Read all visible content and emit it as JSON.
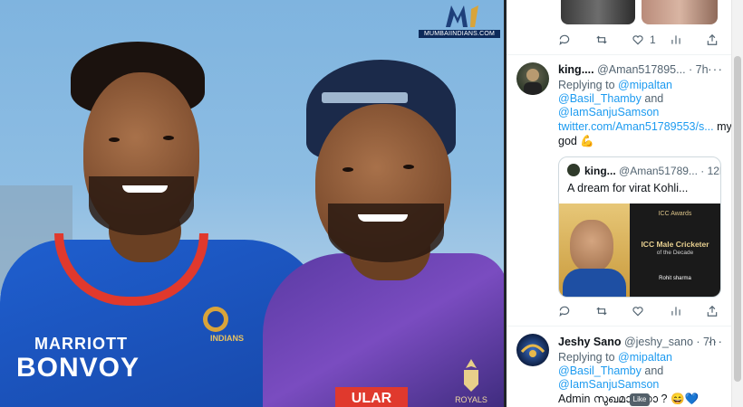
{
  "photo": {
    "logo_text": "MI",
    "url_text": "MUMBAIINDIANS.COM",
    "sponsor_line1": "MARRIOTT",
    "sponsor_line2": "BONVOY",
    "badge_text": "INDIANS",
    "crest_text": "ROYALS",
    "shirt_sponsor": "ULAR"
  },
  "feed": {
    "top_actions": {
      "like_count": "1"
    },
    "tweets": [
      {
        "name": "king....",
        "handle": "@Aman517895...",
        "time": "· 7h",
        "reply_prefix": "Replying to",
        "reply_to_1": "@mipaltan",
        "reply_to_2": "@Basil_Thamby",
        "reply_and": "and",
        "reply_to_3": "@IamSanjuSamson",
        "link": "twitter.com/Aman51789553/s...",
        "text_after_link": "my",
        "text_line2": "god 💪",
        "quote": {
          "name": "king...",
          "handle": "@Aman51789...",
          "time": "· 12h",
          "text": "A dream for virat Kohli...",
          "award_heading": "ICC Awards",
          "award_title_1": "ICC Male Cricketer",
          "award_title_2": "of the Decade",
          "award_name": "Rohit sharma"
        }
      },
      {
        "name": "Jeshy Sano",
        "handle": "@jeshy_sano",
        "time": "· 7h",
        "reply_prefix": "Replying to",
        "reply_to_1": "@mipaltan",
        "reply_to_2": "@Basil_Thamby",
        "reply_and": "and",
        "reply_to_3": "@IamSanjuSamson",
        "text": "Admin സുഖമാണോ ? 😄💙"
      }
    ],
    "like_tooltip": "Like"
  },
  "colors": {
    "link": "#1d9bf0",
    "muted": "#536471",
    "mi_blue": "#1f5fcf",
    "rr_purple": "#5a3aa3"
  }
}
